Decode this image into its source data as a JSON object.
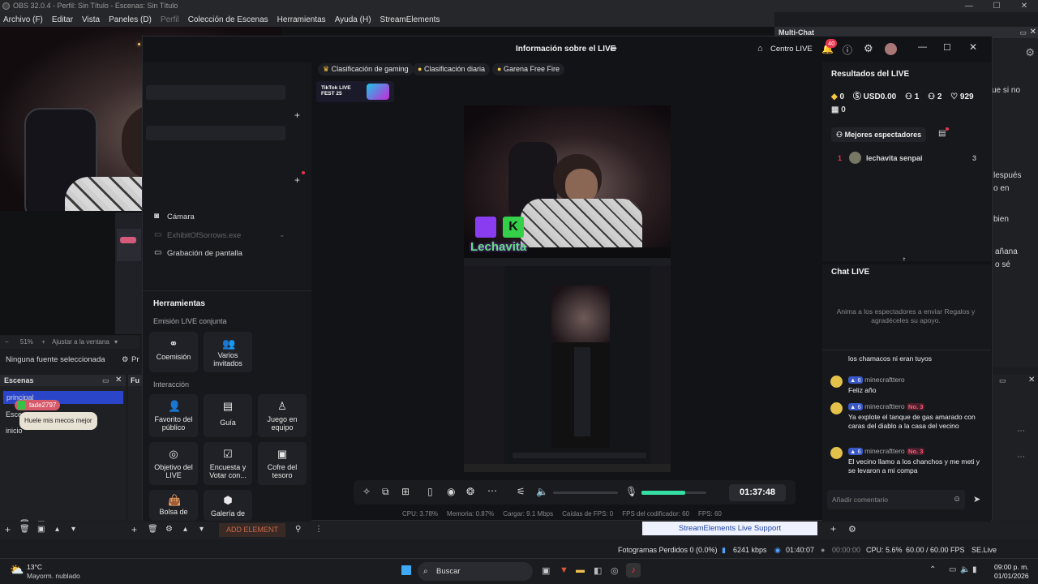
{
  "obs": {
    "title": "OBS 32.0.4 - Perfil: Sin Título - Escenas: Sin Título",
    "menu": [
      "Archivo (F)",
      "Editar",
      "Vista",
      "Paneles (D)",
      "Perfil",
      "Colección de Escenas",
      "Herramientas",
      "Ayuda (H)",
      "StreamElements"
    ],
    "zoom": "51%",
    "zoom_label": "Ajustar a la ventana",
    "no_source": "Ninguna fuente seleccionada",
    "properties_short": "Pr",
    "scenes_title": "Escenas",
    "scenes": [
      "principal",
      "Escen",
      "inicio"
    ],
    "sources_title": "Fu",
    "add_element": "ADD ELEMENT",
    "twitch_user": "tade2797",
    "twitch_msg": "Huele mis mecos mejor",
    "se_support": "StreamElements Live Support",
    "multichat": "Multi-Chat",
    "multichat_fragments": [
      "ue si no",
      "lespués",
      "o en",
      "bien",
      "añana",
      "o sé"
    ],
    "status": {
      "dropped": "Fotogramas Perdidos 0 (0.0%)",
      "kbps": "6241 kbps",
      "live_time": "01:40:07",
      "rec_time": "00:00:00",
      "cpu": "CPU: 5.6%",
      "fps": "60.00 / 60.00 FPS",
      "version": "SE.Live 25.12.15.535"
    }
  },
  "live": {
    "title": "Información sobre el LIVE",
    "centro": "Centro LIVE",
    "notif_count": "40",
    "chips": [
      "Clasificación de gaming",
      "Clasificación diaria",
      "Garena Free Fire"
    ],
    "fest": "TikTok LIVE FEST 25",
    "left_items": {
      "camara": "Cámara",
      "exhibit": "ExhibitOfSorrows.exe",
      "grabacion": "Grabación de pantalla"
    },
    "tools_title": "Herramientas",
    "joint_title": "Emisión LIVE conjunta",
    "joint": [
      "Coemisión",
      "Varios invitados"
    ],
    "interaction_title": "Interacción",
    "interaction": [
      "Favorito del público",
      "Guía",
      "Juego en equipo",
      "Objetivo del LIVE",
      "Encuesta y Votar con...",
      "Cofre del tesoro",
      "Bolsa de",
      "Galería de"
    ],
    "brand": "Lechavita",
    "timer": "01:37:48",
    "stats": [
      "CPU: 3.78%",
      "Memoria: 0.87%",
      "Cargar: 9.1 Mbps",
      "Caídas de FPS: 0",
      "FPS del codificador: 60",
      "FPS: 60"
    ],
    "results_title": "Resultados del LIVE",
    "results": [
      "0",
      "USD0.00",
      "1",
      "2",
      "929",
      "0"
    ],
    "top_viewers": "Mejores espectadores",
    "viewer_rank": "1",
    "viewer_name": "lechavita senpai",
    "viewer_score": "3",
    "chat_title": "Chat LIVE",
    "chat_hint": "Anima a los espectadores a enviar Regalos y agradéceles su apoyo.",
    "messages": [
      {
        "user": "",
        "badge": "",
        "text": "los chamacos ni eran tuyos"
      },
      {
        "user": "minecrafttero",
        "badge": "",
        "text": "Feliz año"
      },
      {
        "user": "minecrafttero",
        "badge": "No. 3",
        "text": "Ya explote el tanque de gas amarado con caras del diablo a la casa del vecino"
      },
      {
        "user": "minecrafttero",
        "badge": "No. 3",
        "text": "El vecino llamo a los chanchos y me meti y se levaron a mi compa"
      }
    ],
    "level": "6",
    "comment_placeholder": "Añadir comentario"
  },
  "weather": {
    "temp": "13°C",
    "desc": "Mayorm. nublado"
  },
  "taskbar": {
    "search": "Buscar",
    "time": "09:00 p. m.",
    "date": "01/01/2026"
  }
}
